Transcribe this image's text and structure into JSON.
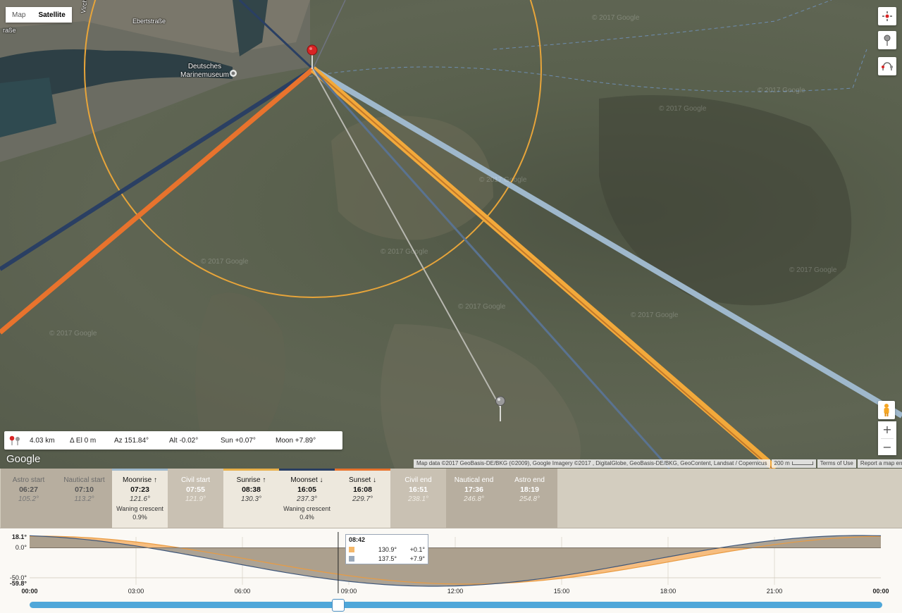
{
  "map": {
    "maptype": {
      "map_label": "Map",
      "satellite_label": "Satellite"
    },
    "labels": {
      "street1": "Ebertstraße",
      "street2": "Virchow",
      "street3": "raße",
      "museum_line1": "Deutsches",
      "museum_line2": "Marinemuseum"
    },
    "watermark": "© 2017 Google",
    "infobar": {
      "distance": "4.03 km",
      "elev": "Δ El  0 m",
      "az": "Az 151.84°",
      "alt": "Alt  -0.02°",
      "sun": "Sun +0.07°",
      "moon": "Moon +7.89°"
    },
    "logo": "Google",
    "attribution": "Map data ©2017 GeoBasis-DE/BKG (©2009), Google Imagery ©2017 , DigitalGlobe, GeoBasis-DE/BKG, GeoContent, Landsat / Copernicus",
    "scale": "200 m",
    "terms": "Terms of Use",
    "report": "Report a map error",
    "zoom_in": "+",
    "zoom_out": "−",
    "colors": {
      "sun": "#f2a93b",
      "moon": "#9fb8cc",
      "rise": "#e8732d",
      "set": "#2a3f63",
      "circle": "#e8a53a"
    }
  },
  "events": [
    {
      "name": "Astro start",
      "time": "06:27",
      "az": "105.2°",
      "style": "dark"
    },
    {
      "name": "Nautical start",
      "time": "07:10",
      "az": "113.2°",
      "style": "dark"
    },
    {
      "name": "Moonrise ↑",
      "time": "07:23",
      "az": "121.6°",
      "phase": "Waning crescent",
      "pct": "0.9%",
      "style": "light",
      "accent": "#9fb8cc"
    },
    {
      "name": "Civil start",
      "time": "07:55",
      "az": "121.9°",
      "style": "mid dim"
    },
    {
      "name": "Sunrise ↑",
      "time": "08:38",
      "az": "130.3°",
      "style": "light",
      "accent": "#e8b04a"
    },
    {
      "name": "Moonset ↓",
      "time": "16:05",
      "az": "237.3°",
      "phase": "Waning crescent",
      "pct": "0.4%",
      "style": "light",
      "accent": "#2a3f63"
    },
    {
      "name": "Sunset ↓",
      "time": "16:08",
      "az": "229.7°",
      "style": "light",
      "accent": "#e8732d"
    },
    {
      "name": "Civil end",
      "time": "16:51",
      "az": "238.1°",
      "style": "mid dim"
    },
    {
      "name": "Nautical end",
      "time": "17:36",
      "az": "246.8°",
      "style": "dark dim"
    },
    {
      "name": "Astro end",
      "time": "18:19",
      "az": "254.8°",
      "style": "dark dim"
    }
  ],
  "timeline": {
    "y_labels": [
      "18.1°",
      "0.0°",
      "-50.0°",
      "-59.8°"
    ],
    "x_labels": [
      "00:00",
      "03:00",
      "06:00",
      "09:00",
      "12:00",
      "15:00",
      "18:00",
      "21:00",
      "00:00"
    ],
    "tooltip": {
      "time": "08:42",
      "rows": [
        {
          "color": "#f5b86a",
          "az": "130.9°",
          "alt": "+0.1°"
        },
        {
          "color": "#9aa9bb",
          "az": "137.5°",
          "alt": "+7.9°"
        }
      ]
    },
    "current_time": "08:42"
  }
}
